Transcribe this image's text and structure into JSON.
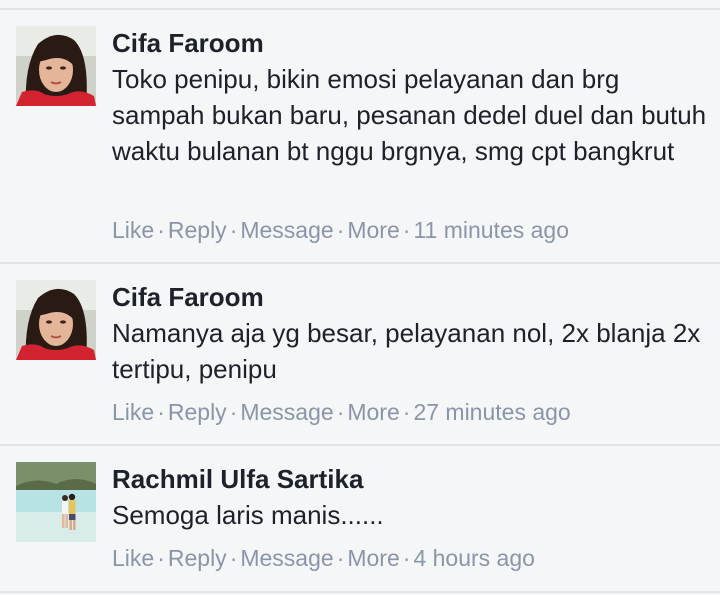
{
  "comments": [
    {
      "author": "Cifa Faroom",
      "avatar": "woman-portrait-avatar",
      "text": "Toko penipu, bikin emosi pelayanan dan brg sampah bukan baru, pesanan dedel duel dan butuh waktu bulanan bt nggu brgnya, smg cpt bangkrut",
      "actions": {
        "like": "Like",
        "reply": "Reply",
        "message": "Message",
        "more": "More"
      },
      "time": "11 minutes ago"
    },
    {
      "author": "Cifa Faroom",
      "avatar": "woman-portrait-avatar",
      "text": "Namanya aja yg besar, pelayanan nol, 2x blanja 2x tertipu, penipu",
      "actions": {
        "like": "Like",
        "reply": "Reply",
        "message": "Message",
        "more": "More"
      },
      "time": "27 minutes ago"
    },
    {
      "author": "Rachmil Ulfa Sartika",
      "avatar": "couple-beach-avatar",
      "text": "Semoga laris manis......",
      "actions": {
        "like": "Like",
        "reply": "Reply",
        "message": "Message",
        "more": "More"
      },
      "time": "4 hours ago"
    }
  ],
  "separator": "·",
  "colors": {
    "background": "#f5f6f8",
    "divider": "#e2e3e6",
    "author_text": "#1d2129",
    "action_text": "#8b95a8"
  }
}
